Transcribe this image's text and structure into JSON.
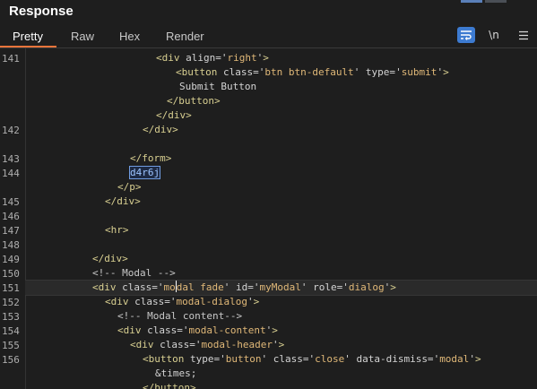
{
  "header": {
    "title": "Response"
  },
  "tabs": [
    {
      "label": "Pretty",
      "active": true
    },
    {
      "label": "Raw"
    },
    {
      "label": "Hex"
    },
    {
      "label": "Render"
    }
  ],
  "toolbar": {
    "wrap_icon": "wrap-lines-icon",
    "newline_label": "\\n",
    "menu_icon": "hamburger-menu-icon"
  },
  "colors": {
    "accent": "#e8743b",
    "active_button": "#3d7bd1",
    "tag": "#d8cf91",
    "value": "#e0b878"
  },
  "line_numbers": [
    "141",
    "142",
    "143",
    "144",
    "145",
    "146",
    "147",
    "148",
    "149",
    "150",
    "151",
    "152",
    "153",
    "154",
    "155",
    "156"
  ],
  "code": {
    "l1_tag": "<div",
    "l1_attr": " align=",
    "l1_val": "right",
    "l1_close": ">",
    "l2_tag": "<button",
    "l2_attr1": " class=",
    "l2_val1": "btn btn-default",
    "l2_attr2": " type=",
    "l2_val2": "submit",
    "l2_close": ">",
    "l3_text": "Submit Button",
    "l4_tag": "</button>",
    "l5_tag": "</div>",
    "l6_tag": "</div>",
    "l7_tag": "</form>",
    "l8_text": "d4r6j",
    "l9_tag": "</p>",
    "l10_tag": "</div>",
    "l11_tag": "<hr>",
    "l12_tag": "</div>",
    "l13_comment": "<!-- Modal -->",
    "l14_tag": "<div",
    "l14_attr1": " class=",
    "l14_val1a": "mo",
    "l14_val1b": "dal fade",
    "l14_attr2": " id=",
    "l14_val2": "myModal",
    "l14_attr3": " role=",
    "l14_val3": "dialog",
    "l14_close": ">",
    "l15_tag": "<div",
    "l15_attr": " class=",
    "l15_val": "modal-dialog",
    "l15_close": ">",
    "l16_comment": "<!-- Modal content-->",
    "l17_tag": "<div",
    "l17_attr": " class=",
    "l17_val": "modal-content",
    "l17_close": ">",
    "l18_tag": "<div",
    "l18_attr": " class=",
    "l18_val": "modal-header",
    "l18_close": ">",
    "l19_tag": "<button",
    "l19_attr1": " type=",
    "l19_val1": "button",
    "l19_attr2": " class=",
    "l19_val2": "close",
    "l19_attr3": " data-dismiss=",
    "l19_val3": "modal",
    "l19_close": ">",
    "l20_text": "&times;",
    "l21_tag": "</button>"
  }
}
